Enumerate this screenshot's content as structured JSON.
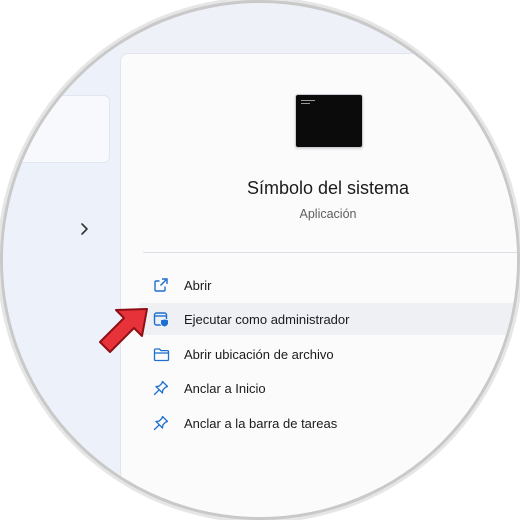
{
  "app": {
    "title": "Símbolo del sistema",
    "subtitle": "Aplicación",
    "icon": "command-prompt-icon"
  },
  "left_pane": {
    "expand_icon": "chevron-right-icon"
  },
  "menu": {
    "items": [
      {
        "label": "Abrir",
        "icon": "open-external-icon"
      },
      {
        "label": "Ejecutar como administrador",
        "icon": "run-as-admin-shield-icon",
        "highlighted": true
      },
      {
        "label": "Abrir ubicación de archivo",
        "icon": "folder-icon"
      },
      {
        "label": "Anclar a Inicio",
        "icon": "pin-icon"
      },
      {
        "label": "Anclar a la barra de tareas",
        "icon": "pin-icon"
      }
    ]
  },
  "colors": {
    "accent": "#1f6fd1",
    "pointer_arrow": "#e8323a"
  }
}
